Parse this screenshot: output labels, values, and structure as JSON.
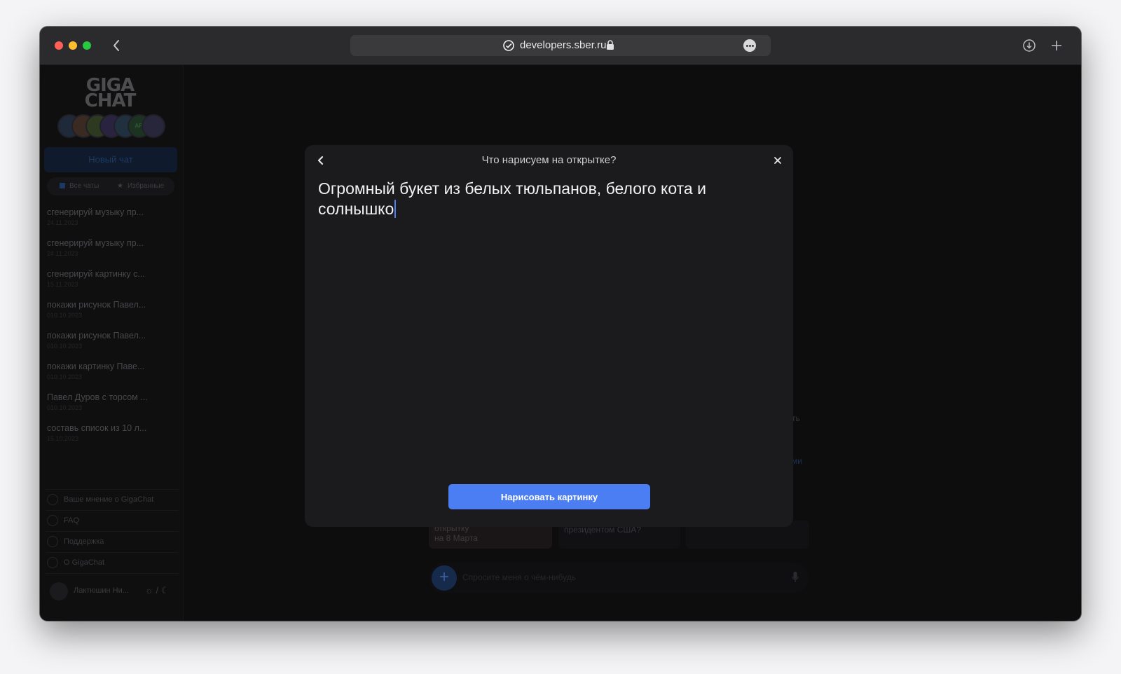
{
  "browser": {
    "url": "developers.sber.ru"
  },
  "sidebar": {
    "brand": "GIGA CHAT",
    "bubble_badge": "API",
    "new_chat": "Новый чат",
    "filters": {
      "all": "Все чаты",
      "favorites": "Избранные"
    },
    "chats": [
      {
        "title": "сгенерируй музыку пр...",
        "date": "24.11.2023"
      },
      {
        "title": "сгенерируй музыку пр...",
        "date": "24.11.2023"
      },
      {
        "title": "сгенерируй картинку с...",
        "date": "15.11.2023"
      },
      {
        "title": "покажи рисунок Павел...",
        "date": "010.10.2023"
      },
      {
        "title": "покажи рисунок Павел...",
        "date": "010.10.2023"
      },
      {
        "title": "покажи картинку Паве...",
        "date": "010.10.2023"
      },
      {
        "title": "Павел Дуров с торсом ...",
        "date": "010.10.2023"
      },
      {
        "title": "составь список из 10 л...",
        "date": "15.10.2023"
      }
    ],
    "footer": [
      "Ваше мнение о GigaChat",
      "FAQ",
      "Поддержка",
      "О GigaChat"
    ],
    "user_name": "Лактюшин Ни...",
    "theme_separator": "/"
  },
  "background": {
    "partial_text_1": "ть",
    "partial_text_2": "ми",
    "card_1": "открытку\nна 8 Марта",
    "card_2": "президентом США?",
    "input_placeholder": "Спросите меня о чём-нибудь"
  },
  "modal": {
    "title": "Что нарисуем на открытке?",
    "prompt_text": "Огромный букет из белых тюльпанов, белого кота и солнышко",
    "submit_label": "Нарисовать картинку"
  },
  "colors": {
    "accent": "#4c7ef3",
    "modal_bg": "#1b1b1d",
    "caret": "#4f7df3"
  }
}
